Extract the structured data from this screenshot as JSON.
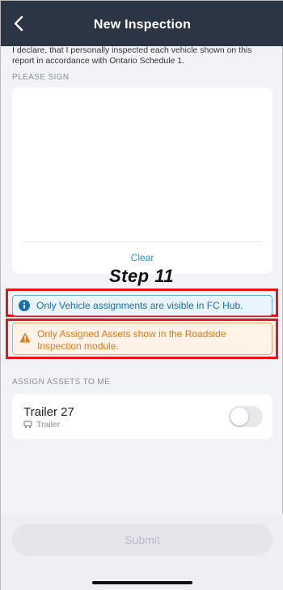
{
  "header": {
    "title": "New Inspection",
    "back_icon": "chevron-left-icon"
  },
  "declaration": "I declare, that I personally inspected each vehicle shown on this report in accordance with Ontario Schedule 1.",
  "signature": {
    "label": "PLEASE SIGN",
    "clear_label": "Clear"
  },
  "annotation": {
    "step": "Step 11",
    "highlight_color": "#e8141b"
  },
  "banners": {
    "info": {
      "text": "Only Vehicle assignments are visible in FC Hub.",
      "icon": "info-icon",
      "color": "#1b6fae"
    },
    "warning": {
      "text": "Only Assigned Assets show in the Roadside Inspection module.",
      "icon": "warning-icon",
      "color": "#e27b1b"
    }
  },
  "assets": {
    "section_label": "ASSIGN ASSETS TO ME",
    "items": [
      {
        "name": "Trailer 27",
        "type": "Trailer",
        "icon": "trailer-icon",
        "assigned": false
      }
    ]
  },
  "footer": {
    "submit_label": "Submit",
    "submit_enabled": false
  },
  "colors": {
    "header_bg": "#2b3544",
    "accent": "#2f8fd3"
  }
}
